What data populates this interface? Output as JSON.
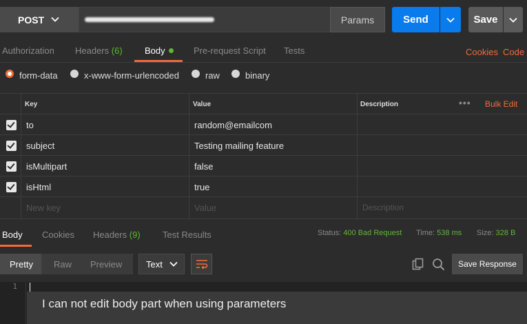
{
  "request": {
    "method": "POST",
    "params_label": "Params",
    "send_label": "Send",
    "save_label": "Save"
  },
  "req_tabs": {
    "authorization": "Authorization",
    "headers": "Headers",
    "headers_count": "(6)",
    "body": "Body",
    "prerequest": "Pre-request Script",
    "tests": "Tests",
    "cookies": "Cookies",
    "code": "Code"
  },
  "body_types": {
    "form_data": "form-data",
    "urlencoded": "x-www-form-urlencoded",
    "raw": "raw",
    "binary": "binary",
    "selected": "form-data"
  },
  "kv_table": {
    "headers": {
      "key": "Key",
      "value": "Value",
      "description": "Description",
      "more": "•••",
      "bulk_edit": "Bulk Edit"
    },
    "rows": [
      {
        "key": "to",
        "value": "random@emailcom",
        "checked": true
      },
      {
        "key": "subject",
        "value": "Testing mailing feature",
        "checked": true
      },
      {
        "key": "isMultipart",
        "value": "false",
        "checked": true
      },
      {
        "key": "isHtml",
        "value": "true",
        "checked": true
      }
    ],
    "placeholder": {
      "key": "New key",
      "value": "Value",
      "description": "Description"
    }
  },
  "res_tabs": {
    "body": "Body",
    "cookies": "Cookies",
    "headers": "Headers",
    "headers_count": "(9)",
    "test_results": "Test Results",
    "status_label": "Status:",
    "status_value": "400 Bad Request",
    "time_label": "Time:",
    "time_value": "538 ms",
    "size_label": "Size:",
    "size_value": "328 B"
  },
  "res_toolbar": {
    "pretty": "Pretty",
    "raw": "Raw",
    "preview": "Preview",
    "format": "Text",
    "save_response": "Save Response"
  },
  "editor": {
    "line_number": "1",
    "overlay_text": "I can not edit body part when using parameters"
  },
  "colors": {
    "accent": "#f26b3a",
    "send": "#097bed",
    "success": "#5fb832"
  }
}
